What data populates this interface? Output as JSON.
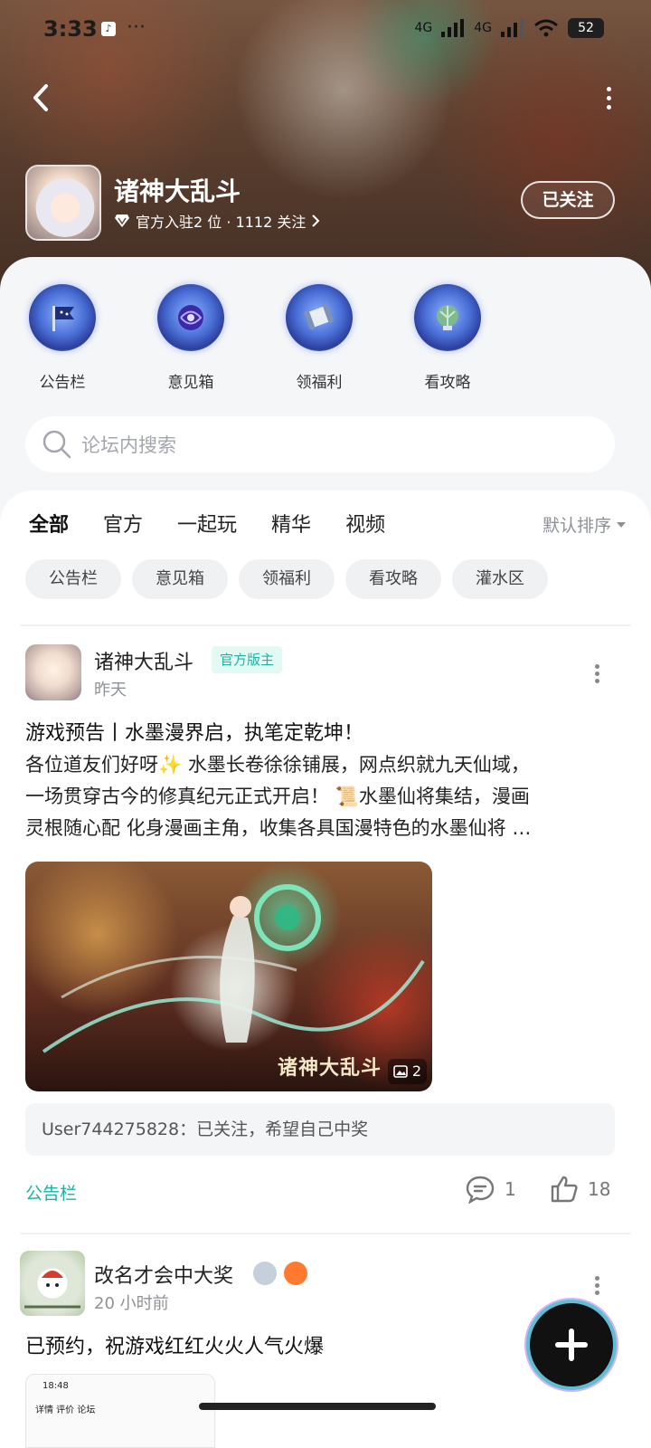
{
  "status_bar": {
    "time": "3:33",
    "dots": "···",
    "net1": "4G",
    "net2": "4G",
    "battery": "52"
  },
  "forum": {
    "title": "诸神大乱斗",
    "meta": "官方入驻2 位 · 1112 关注",
    "follow_label": "已关注"
  },
  "quick_links": [
    {
      "label": "公告栏",
      "icon": "banner-flag-icon",
      "color": "#3b5fc4"
    },
    {
      "label": "意见箱",
      "icon": "galaxy-icon",
      "color": "#5a4ed6"
    },
    {
      "label": "领福利",
      "icon": "scroll-icon",
      "color": "#3c66c9"
    },
    {
      "label": "看攻略",
      "icon": "leaf-book-icon",
      "color": "#4d7acc"
    }
  ],
  "search": {
    "placeholder": "论坛内搜索"
  },
  "tabs": [
    "全部",
    "官方",
    "一起玩",
    "精华",
    "视频"
  ],
  "sort_label": "默认排序",
  "chips": [
    "公告栏",
    "意见箱",
    "领福利",
    "看攻略",
    "灌水区"
  ],
  "post1": {
    "author": "诸神大乱斗",
    "badge": "官方版主",
    "time": "昨天",
    "title": "游戏预告丨水墨漫界启，执笔定乾坤！",
    "body_lines": [
      "各位道友们好呀✨ 水墨长卷徐徐铺展，网点织就九天仙域，",
      "一场贯穿古今的修真纪元正式开启！ 📜水墨仙将集结，漫画",
      "灵根随心配 化身漫画主角，收集各具国漫特色的水墨仙将 …"
    ],
    "image_logo": "诸神大乱斗",
    "image_count": "2",
    "comment_preview": "User744275828：已关注，希望自己中奖",
    "tag": "公告栏",
    "comments": "1",
    "likes": "18"
  },
  "post2": {
    "author": "改名才会中大奖",
    "time": "20 小时前",
    "body": "已预约，祝游戏红红火火人气火爆",
    "thumb_time": "18:48",
    "thumb_nav": "详情   评价   论坛"
  },
  "colors": {
    "accent": "#19c4b0",
    "tag": "#19b5a3"
  }
}
